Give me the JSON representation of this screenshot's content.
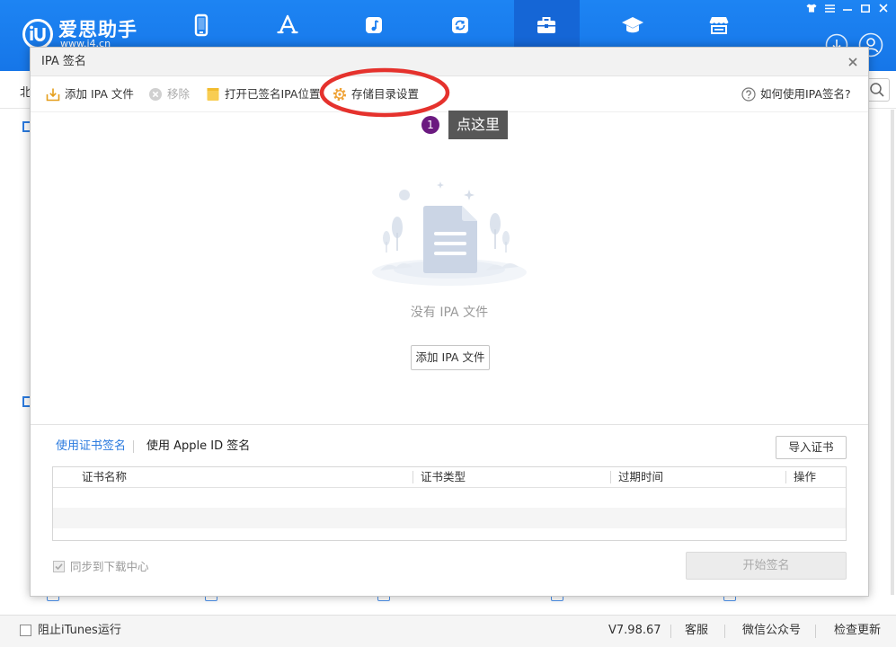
{
  "header": {
    "logo_title": "爱思助手",
    "logo_subtitle": "www.i4.cn",
    "logo_icon": "i4-logo-icon",
    "nav_icons": [
      "phone-icon",
      "app-store-icon",
      "music-icon",
      "sync-icon",
      "toolbox-icon",
      "graduation-cap-icon",
      "store-icon"
    ],
    "active_nav_index": 4,
    "window_control_icons": [
      "skin-icon",
      "menu-icon",
      "minimize-icon",
      "maximize-icon",
      "close-icon"
    ],
    "action_icons": [
      "download-icon",
      "user-icon"
    ]
  },
  "background_page": {
    "partial_text": "北",
    "search_icon": "search-icon"
  },
  "dialog": {
    "title": "IPA 签名",
    "close_icon": "close-icon",
    "toolbar": {
      "add_label": "添加 IPA 文件",
      "remove_label": "移除",
      "remove_enabled": false,
      "open_signed_label": "打开已签名IPA位置",
      "storage_settings_label": "存储目录设置",
      "help_label": "如何使用IPA签名?"
    },
    "empty_state": {
      "message": "没有 IPA 文件",
      "button_label": "添加 IPA 文件"
    },
    "sign_tabs": [
      {
        "label": "使用证书签名",
        "active": true
      },
      {
        "label": "使用 Apple ID 签名",
        "active": false
      }
    ],
    "import_cert_label": "导入证书",
    "cert_table": {
      "columns": [
        "证书名称",
        "证书类型",
        "过期时间",
        "操作"
      ],
      "rows": []
    },
    "sync_label": "同步到下载中心",
    "sync_checked": true,
    "start_sign_label": "开始签名",
    "start_sign_enabled": false
  },
  "annotation": {
    "step_number": "1",
    "hint_text": "点这里"
  },
  "status_bar": {
    "block_itunes_label": "阻止iTunes运行",
    "block_itunes_checked": false,
    "version": "V7.98.67",
    "links": [
      "客服",
      "微信公众号",
      "检查更新"
    ]
  },
  "colors": {
    "header_blue": "#1a7ef0",
    "active_nav": "#1566d6",
    "accent_blue": "#2b7bdf",
    "annotation_red": "#e5322d",
    "step_badge": "#6b1a80",
    "hint_background": "#575757"
  }
}
